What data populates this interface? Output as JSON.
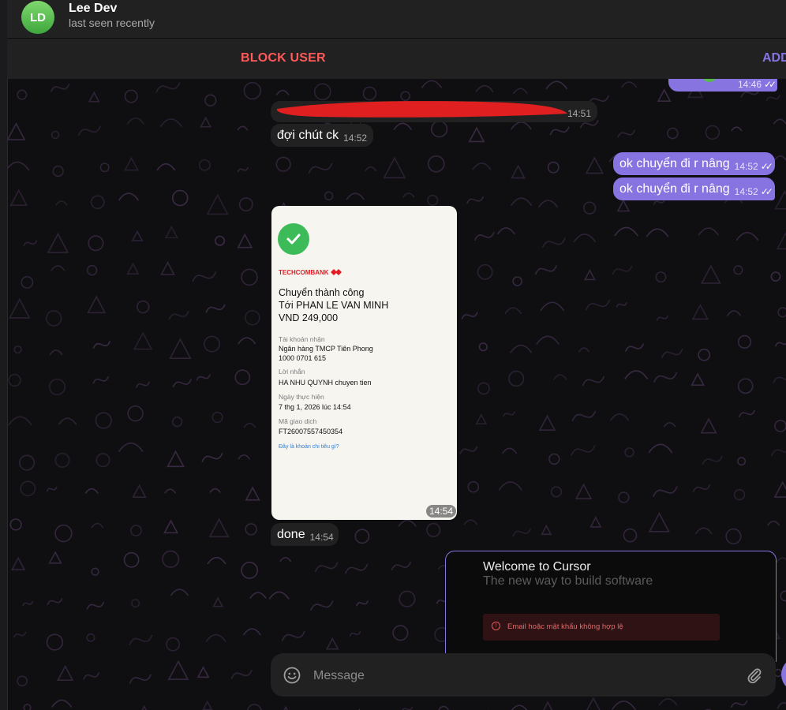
{
  "header": {
    "avatar_initials": "LD",
    "name": "Lee Dev",
    "status": "last seen recently"
  },
  "actions": {
    "block_label": "BLOCK USER",
    "add_label": "ADD"
  },
  "messages": {
    "top_out_time": "14:46",
    "m1_time": "14:51",
    "m2_text": "đợi chút ck",
    "m2_time": "14:52",
    "m3_text": "ok chuyển đi r nâng",
    "m3_time": "14:52",
    "m4_text": "ok chuyển đi r nâng",
    "m4_time": "14:52",
    "image_time": "14:54",
    "m6_text": "done",
    "m6_time": "14:54"
  },
  "receipt": {
    "brand": "TECHCOMBANK",
    "title1": "Chuyển thành công",
    "title2": "Tới PHAN LE VAN MINH",
    "amount": "VND 249,000",
    "acc_label": "Tài khoản nhận",
    "acc_bank": "Ngân hàng TMCP Tiên Phong",
    "acc_number": "1000 0701 615",
    "note_label": "Lời nhắn",
    "note_value": "HA NHU QUYNH chuyen tien",
    "date_label": "Ngày thực hiện",
    "date_value": "7 thg 1, 2026 lúc 14:54",
    "txn_label": "Mã giao dịch",
    "txn_value": "FT26007557450354",
    "link": "Đây là khoản chi tiêu gì?"
  },
  "cursor_preview": {
    "title": "Welcome to Cursor",
    "subtitle": "The new way to build software",
    "error": "Email hoặc mật khẩu không hợp lệ"
  },
  "composer": {
    "placeholder": "Message"
  },
  "colors": {
    "accent": "#8774e1",
    "danger": "#ff595a",
    "bubble_in": "#212121"
  }
}
